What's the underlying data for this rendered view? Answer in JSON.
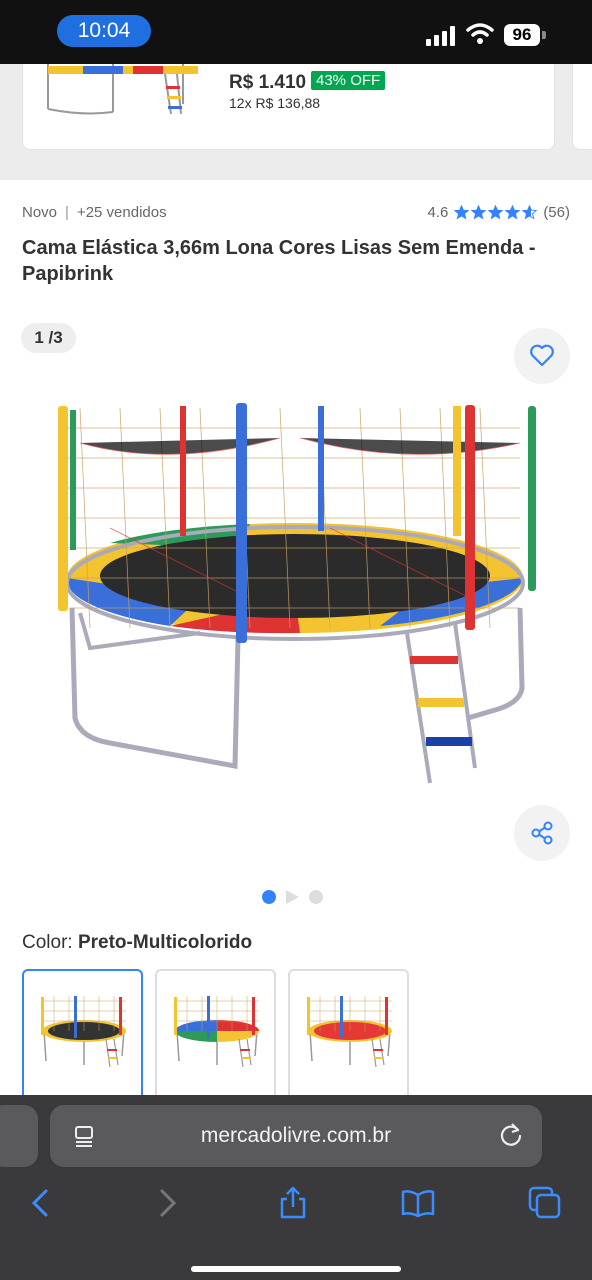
{
  "status": {
    "time": "10:04",
    "battery": "96"
  },
  "recommended": {
    "price": "R$ 1.410",
    "discount": "43% OFF",
    "installments": "12x R$ 136,88"
  },
  "product": {
    "condition": "Novo",
    "sold": "+25 vendidos",
    "rating": "4.6",
    "rating_value": 4.6,
    "reviews": "(56)",
    "title": "Cama Elástica 3,66m Lona Cores Lisas Sem Emenda - Papibrink"
  },
  "gallery": {
    "counter": "1 /3",
    "active_index": 0,
    "total": 3
  },
  "color": {
    "label": "Color:",
    "selected": "Preto-Multicolorido"
  },
  "swatches": [
    {
      "name": "Preto-Multicolorido",
      "mat": "#333333"
    },
    {
      "name": "Colorido",
      "mat": "multi"
    },
    {
      "name": "Vermelho",
      "mat": "#e53935"
    }
  ],
  "browser": {
    "url": "mercadolivre.com.br"
  },
  "colors": {
    "accent": "#3483fa",
    "discount": "#00a650",
    "star": "#3483fa",
    "time_pill": "#1f6fe0"
  },
  "icons": [
    "signal-icon",
    "wifi-icon",
    "heart-icon",
    "share-icon",
    "star-icon",
    "page-menu-icon",
    "reload-icon",
    "back-icon",
    "forward-icon",
    "share-sheet-icon",
    "bookmarks-icon",
    "tabs-icon"
  ]
}
